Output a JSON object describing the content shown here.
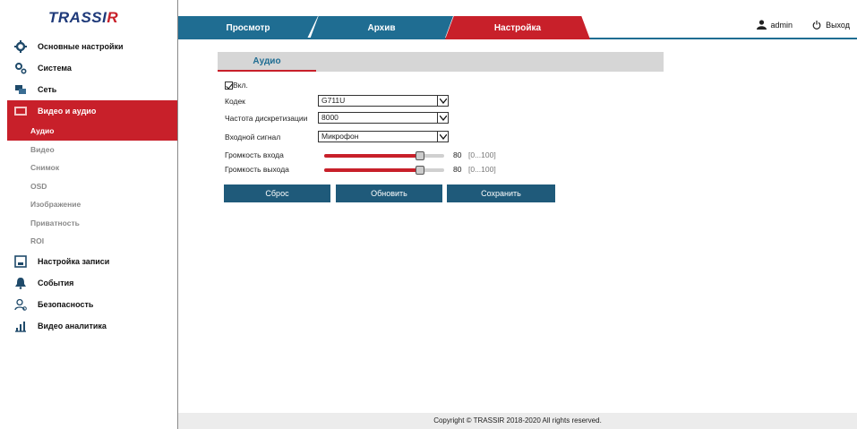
{
  "brand": {
    "logo_main": "TRASSI",
    "logo_accent": "R"
  },
  "tabs": [
    {
      "label": "Просмотр"
    },
    {
      "label": "Архив"
    },
    {
      "label": "Настройка"
    }
  ],
  "user": {
    "name": "admin",
    "logout": "Выход"
  },
  "sidebar": {
    "items": [
      {
        "label": "Основные настройки",
        "icon": "gear-icon"
      },
      {
        "label": "Система",
        "icon": "gears-icon"
      },
      {
        "label": "Сеть",
        "icon": "network-icon"
      },
      {
        "label": "Видео и аудио",
        "icon": "video-icon"
      },
      {
        "label": "Настройка записи",
        "icon": "storage-icon"
      },
      {
        "label": "События",
        "icon": "event-icon"
      },
      {
        "label": "Безопасность",
        "icon": "user-lock-icon"
      },
      {
        "label": "Видео аналитика",
        "icon": "analytics-icon"
      }
    ],
    "subitems": [
      "Аудио",
      "Видео",
      "Снимок",
      "OSD",
      "Изображение",
      "Приватность",
      "ROI"
    ]
  },
  "section": {
    "tab": "Аудио"
  },
  "form": {
    "enable_label": "Вкл.",
    "codec_label": "Кодек",
    "codec_value": "G711U",
    "sample_rate_label": "Частота дискретизации",
    "sample_rate_value": "8000",
    "input_label": "Входной сигнал",
    "input_value": "Микрофон",
    "input_volume_label": "Громкость входа",
    "input_volume_value": "80",
    "output_volume_label": "Громкость выхода",
    "output_volume_value": "80",
    "range_text": "[0...100]"
  },
  "buttons": {
    "reset": "Сброс",
    "refresh": "Обновить",
    "save": "Сохранить"
  },
  "footer": {
    "copyright": "Copyright © TRASSIR 2018-2020 All rights reserved."
  },
  "colors": {
    "accent_red": "#c8202a",
    "accent_blue": "#1f6d92",
    "button_blue": "#1f5a7a"
  }
}
